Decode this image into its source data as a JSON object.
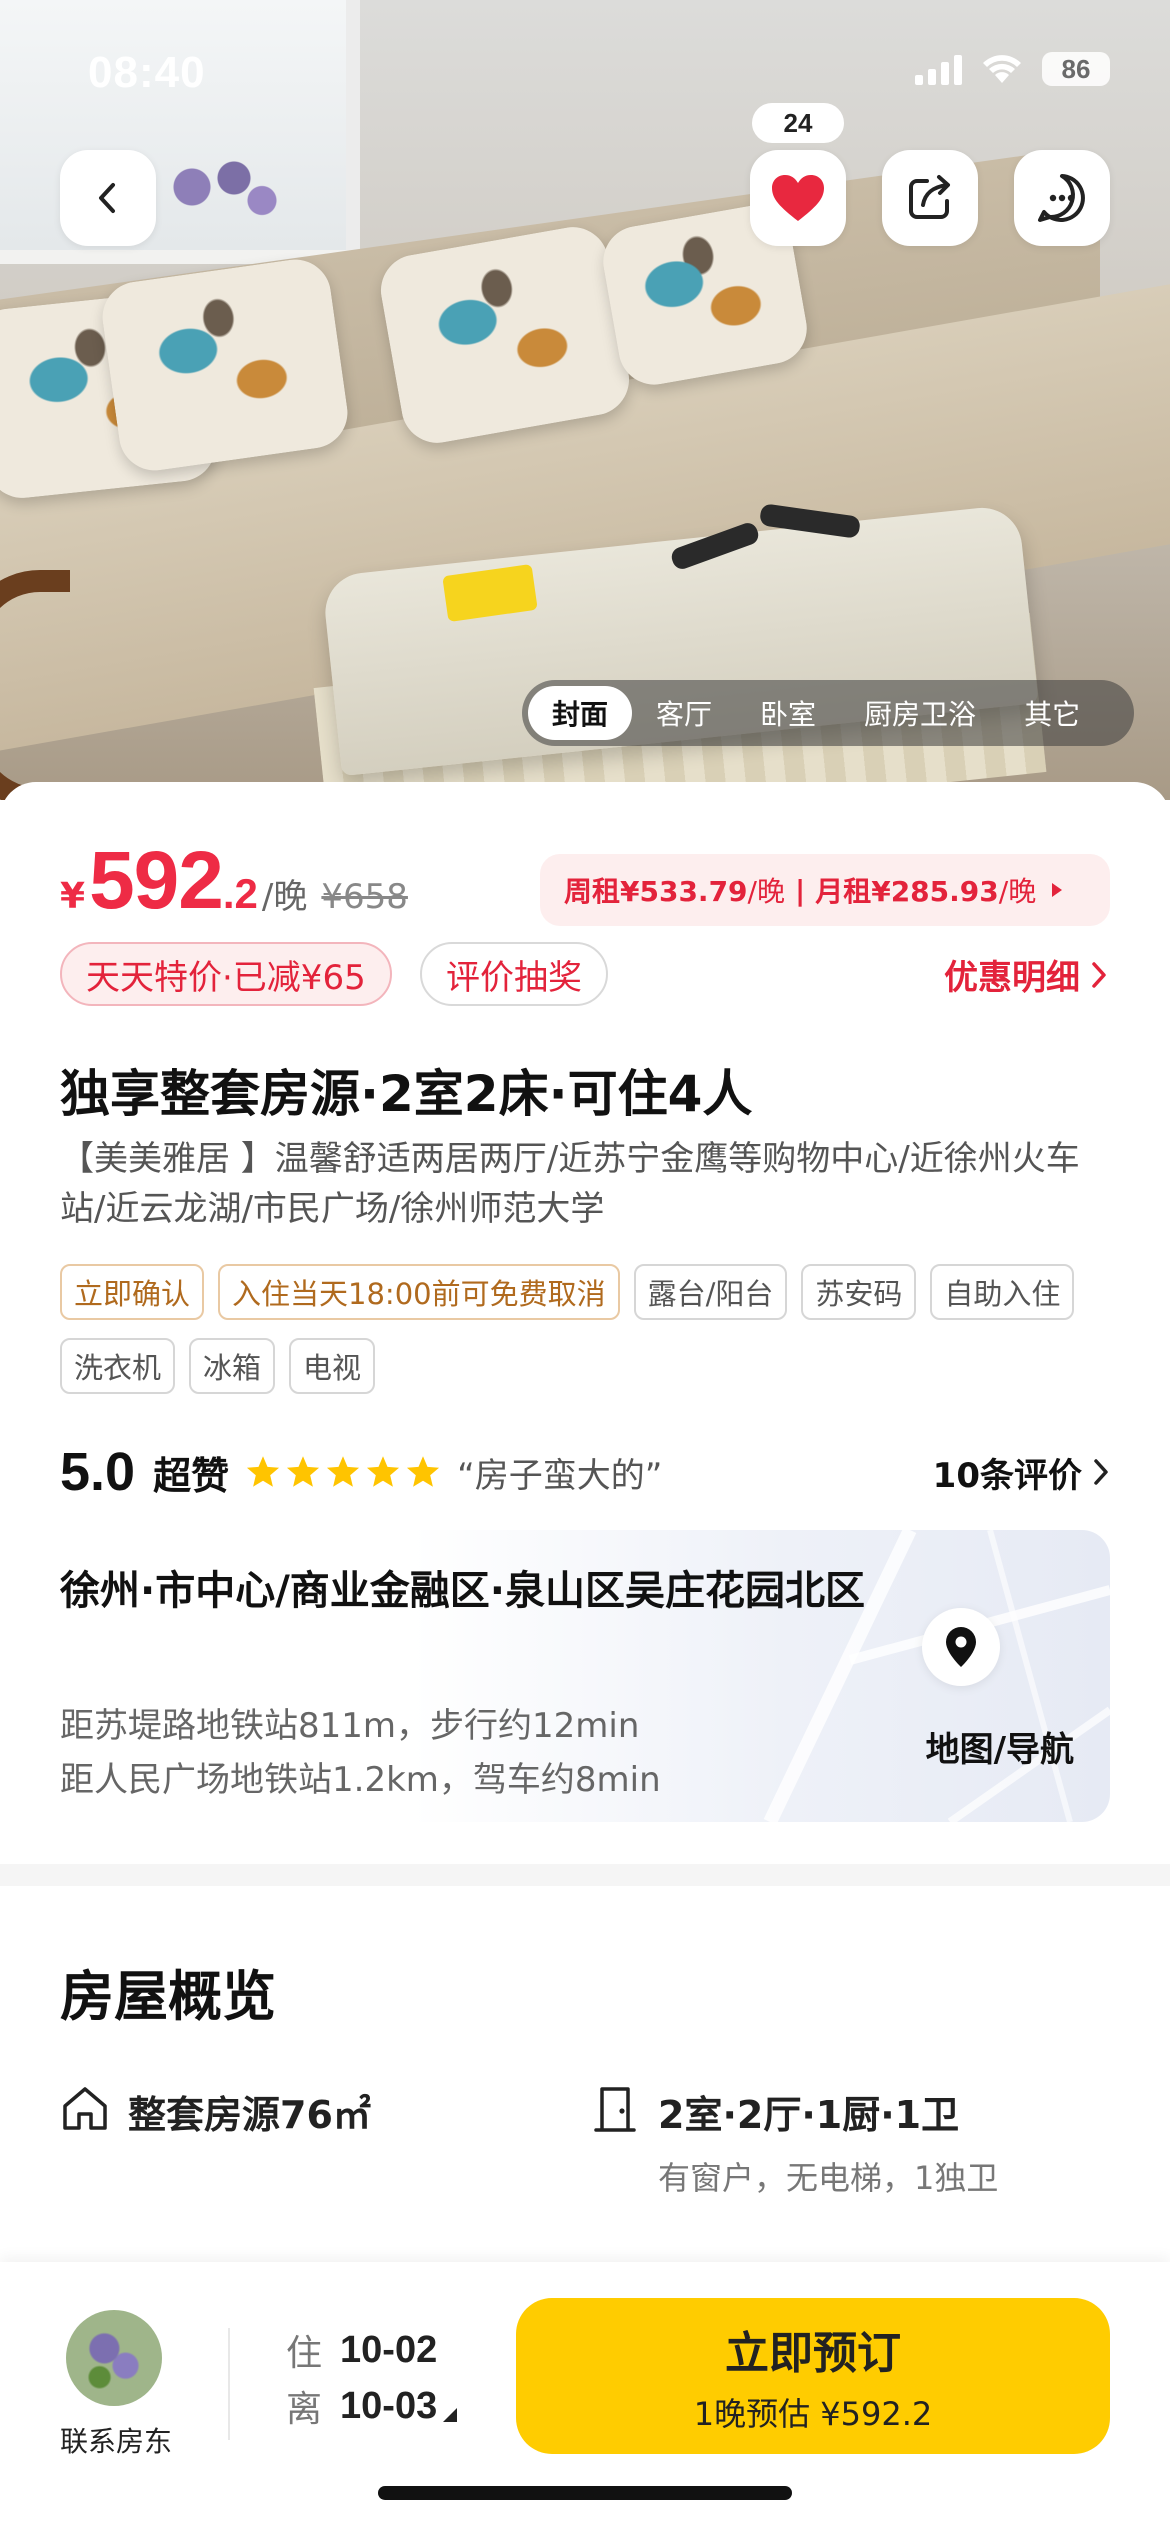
{
  "status_bar": {
    "time": "08:40",
    "battery": "86"
  },
  "top_actions": {
    "favorite_count": "24"
  },
  "photo_tabs": [
    "封面",
    "客厅",
    "卧室",
    "厨房卫浴",
    "其它"
  ],
  "price": {
    "currency": "¥",
    "integer": "592",
    "decimal": ".2",
    "per_night": "/晚",
    "original": "¥658"
  },
  "rent_options": {
    "weekly_label": "周租¥533.79",
    "weekly_unit": "/晚",
    "separator": "|",
    "monthly_label": "月租¥285.93",
    "monthly_unit": "/晚"
  },
  "promos": [
    "天天特价·已减¥65",
    "评价抽奖"
  ],
  "discount_link": "优惠明细",
  "listing": {
    "title": "独享整套房源·2室2床·可住4人",
    "description": "【美美雅居 】温馨舒适两居两厅/近苏宁金鹰等购物中心/近徐州火车站/近云龙湖/市民广场/徐州师范大学"
  },
  "tags": [
    {
      "text": "立即确认",
      "style": "orange"
    },
    {
      "text": "入住当天18:00前可免费取消",
      "style": "orange"
    },
    {
      "text": "露台/阳台",
      "style": "gray"
    },
    {
      "text": "苏安码",
      "style": "gray"
    },
    {
      "text": "自助入住",
      "style": "gray"
    },
    {
      "text": "洗衣机",
      "style": "gray"
    },
    {
      "text": "冰箱",
      "style": "gray"
    },
    {
      "text": "电视",
      "style": "gray"
    }
  ],
  "rating": {
    "score": "5.0",
    "word": "超赞",
    "stars": 5,
    "quote": "“房子蛮大的”",
    "reviews_link": "10条评价"
  },
  "location": {
    "title": "徐州·市中心/商业金融区·泉山区吴庄花园北区",
    "line1": "距苏堤路地铁站811m，步行约12min",
    "line2": "距人民广场地铁站1.2km，驾车约8min",
    "map_label": "地图/导航"
  },
  "overview": {
    "title": "房屋概览",
    "item1_main": "整套房源76㎡",
    "item2_main": "2室·2厅·1厨·1卫",
    "item2_sub": "有窗户，无电梯，1独卫"
  },
  "bottom_bar": {
    "host_label": "联系房东",
    "checkin_key": "住",
    "checkin_date": "10-02",
    "checkout_key": "离",
    "checkout_date": "10-03",
    "book_label": "立即预订",
    "book_sub": "1晚预估 ¥592.2"
  },
  "colors": {
    "price_red": "#ee2b45",
    "book_yellow": "#ffcc00",
    "star_yellow": "#ffc400"
  }
}
